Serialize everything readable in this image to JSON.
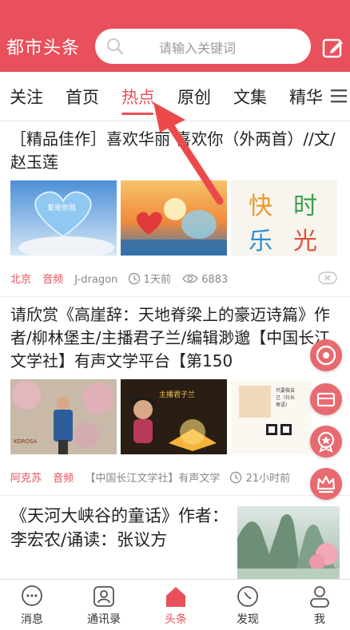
{
  "header": {
    "app_title": "都市头条",
    "search_placeholder": "请输入关键词",
    "bg_color": "#e8505b"
  },
  "tabs": [
    {
      "label": "关注",
      "active": false
    },
    {
      "label": "首页",
      "active": false
    },
    {
      "label": "热点",
      "active": true
    },
    {
      "label": "原创",
      "active": false
    },
    {
      "label": "文集",
      "active": false
    },
    {
      "label": "精华",
      "active": false
    }
  ],
  "articles": [
    {
      "title": "［精品佳作］喜欢华丽 喜欢你（外两首）//文/赵玉莲",
      "thumb_captions": [
        "爱是你我",
        "",
        "快 时 乐 光"
      ],
      "location": "北京",
      "category": "音频",
      "author": "J-dragon",
      "time": "1天前",
      "views": "6883"
    },
    {
      "title": "请欣赏《高崖辞：天地脊梁上的豪迈诗篇》作者/柳林堡主/主播君子兰/编辑渺邈【中国长江文学社】有声文学平台【第150",
      "thumb_captions": [
        "",
        "主播君子兰",
        "只要做自己（社长 寄语）"
      ],
      "location": "阿克苏",
      "category": "音频",
      "author": "【中国长江文学社】有声文学",
      "time": "21小时前"
    },
    {
      "title": "《天河大峡谷的童话》作者：李宏农/诵读：张议方"
    }
  ],
  "bottom_nav": [
    {
      "label": "消息",
      "icon": "chat-bubble-icon",
      "active": false
    },
    {
      "label": "通讯录",
      "icon": "contacts-icon",
      "active": false
    },
    {
      "label": "头条",
      "icon": "home-icon",
      "active": true
    },
    {
      "label": "发现",
      "icon": "compass-icon",
      "active": false
    },
    {
      "label": "我",
      "icon": "person-icon",
      "active": false
    }
  ],
  "fabs": [
    "refresh-icon",
    "gift-card-icon",
    "medal-icon",
    "crown-icon"
  ],
  "accent_color": "#e8505b"
}
